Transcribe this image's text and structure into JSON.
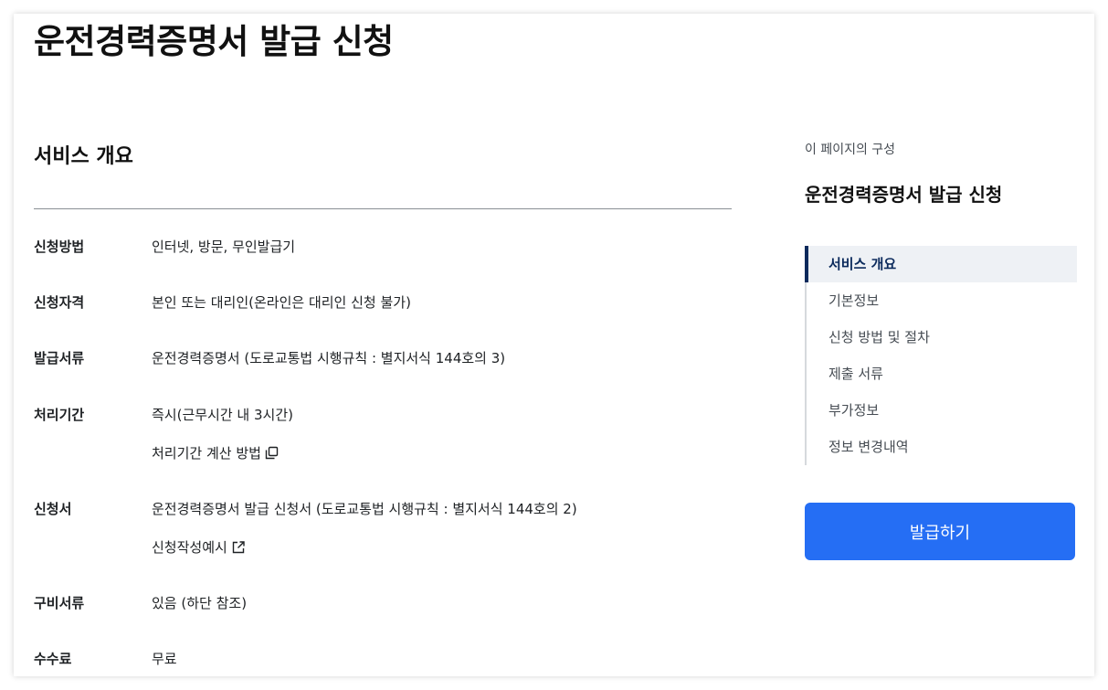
{
  "page": {
    "title": "운전경력증명서 발급 신청"
  },
  "overview": {
    "heading": "서비스 개요",
    "rows": [
      {
        "label": "신청방법",
        "value": "인터넷, 방문, 무인발급기"
      },
      {
        "label": "신청자격",
        "value": "본인 또는 대리인(온라인은 대리인 신청 불가)"
      },
      {
        "label": "발급서류",
        "value": "운전경력증명서 (도로교통법 시행규칙 : 별지서식 144호의 3)"
      },
      {
        "label": "처리기간",
        "value": "즉시(근무시간 내 3시간)",
        "link": "처리기간 계산 방법",
        "link_icon": "copy-icon"
      },
      {
        "label": "신청서",
        "value": "운전경력증명서 발급 신청서 (도로교통법 시행규칙 : 별지서식 144호의 2)",
        "link": "신청작성예시",
        "link_icon": "external-link-icon"
      },
      {
        "label": "구비서류",
        "value": "있음 (하단 참조)"
      },
      {
        "label": "수수료",
        "value": "무료"
      }
    ]
  },
  "toc": {
    "caption": "이 페이지의 구성",
    "title": "운전경력증명서 발급 신청",
    "items": [
      {
        "label": "서비스 개요",
        "active": true
      },
      {
        "label": "기본정보",
        "active": false
      },
      {
        "label": "신청 방법 및 절차",
        "active": false
      },
      {
        "label": "제출 서류",
        "active": false
      },
      {
        "label": "부가정보",
        "active": false
      },
      {
        "label": "정보 변경내역",
        "active": false
      }
    ]
  },
  "actions": {
    "issue_button_label": "발급하기"
  },
  "colors": {
    "primary_button": "#256ef4",
    "toc_active_bar": "#0b2a5c",
    "toc_active_bg": "#eef1f5"
  }
}
